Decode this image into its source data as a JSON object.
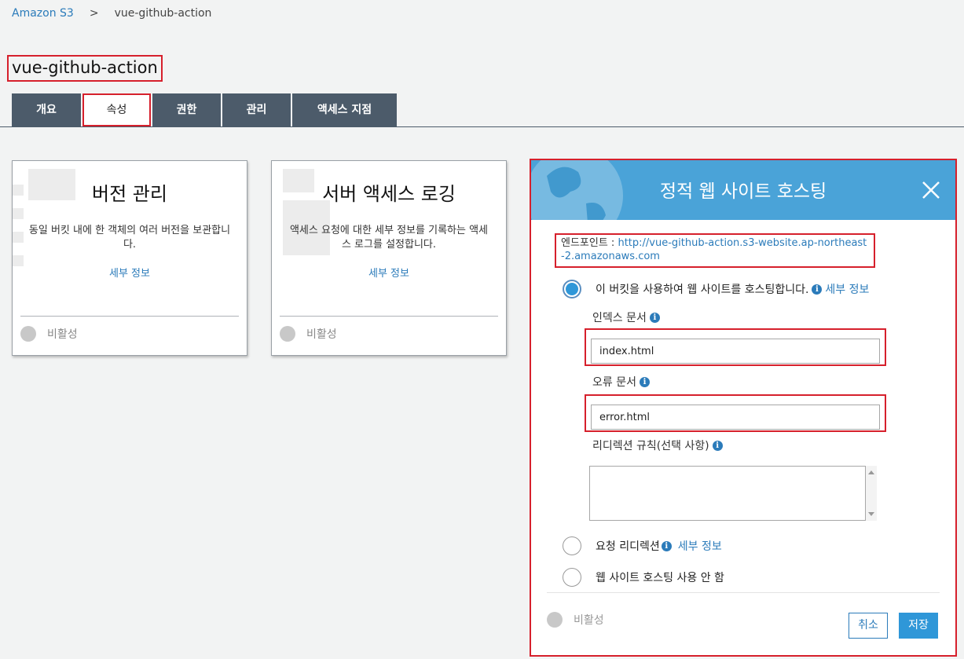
{
  "breadcrumb": {
    "root": "Amazon S3",
    "separator": ">",
    "current": "vue-github-action"
  },
  "page_title": "vue-github-action",
  "tabs": [
    {
      "label": "개요"
    },
    {
      "label": "속성"
    },
    {
      "label": "권한"
    },
    {
      "label": "관리"
    },
    {
      "label": "액세스 지점"
    }
  ],
  "cards": {
    "versioning": {
      "title": "버전 관리",
      "description": "동일 버킷 내에 한 객체의 여러 버전을 보관합니다.",
      "more_link": "세부 정보",
      "status": "비활성"
    },
    "logging": {
      "title": "서버 액세스 로깅",
      "description": "액세스 요청에 대한 세부 정보를 기록하는 액세스 로그를 설정합니다.",
      "more_link": "세부 정보",
      "status": "비활성"
    }
  },
  "hosting": {
    "title": "정적 웹 사이트 호스팅",
    "endpoint_label": "엔드포인트 :",
    "endpoint_url": "http://vue-github-action.s3-website.ap-northeast-2.amazonaws.com",
    "option_host": "이 버킷을 사용하여 웹 사이트를 호스팅합니다.",
    "option_host_more": "세부 정보",
    "index_label": "인덱스 문서",
    "index_value": "index.html",
    "error_label": "오류 문서",
    "error_value": "error.html",
    "redirect_rules_label": "리디렉션 규칙(선택 사항)",
    "redirect_rules_value": "",
    "option_redirect": "요청 리디렉션",
    "option_redirect_more": "세부 정보",
    "option_disable": "웹 사이트 호스팅 사용 안 함",
    "status": "비활성",
    "cancel": "취소",
    "save": "저장",
    "colors": {
      "header": "#4aa3d8",
      "accent": "#2f97d8",
      "highlight_border": "#d6202c"
    }
  }
}
